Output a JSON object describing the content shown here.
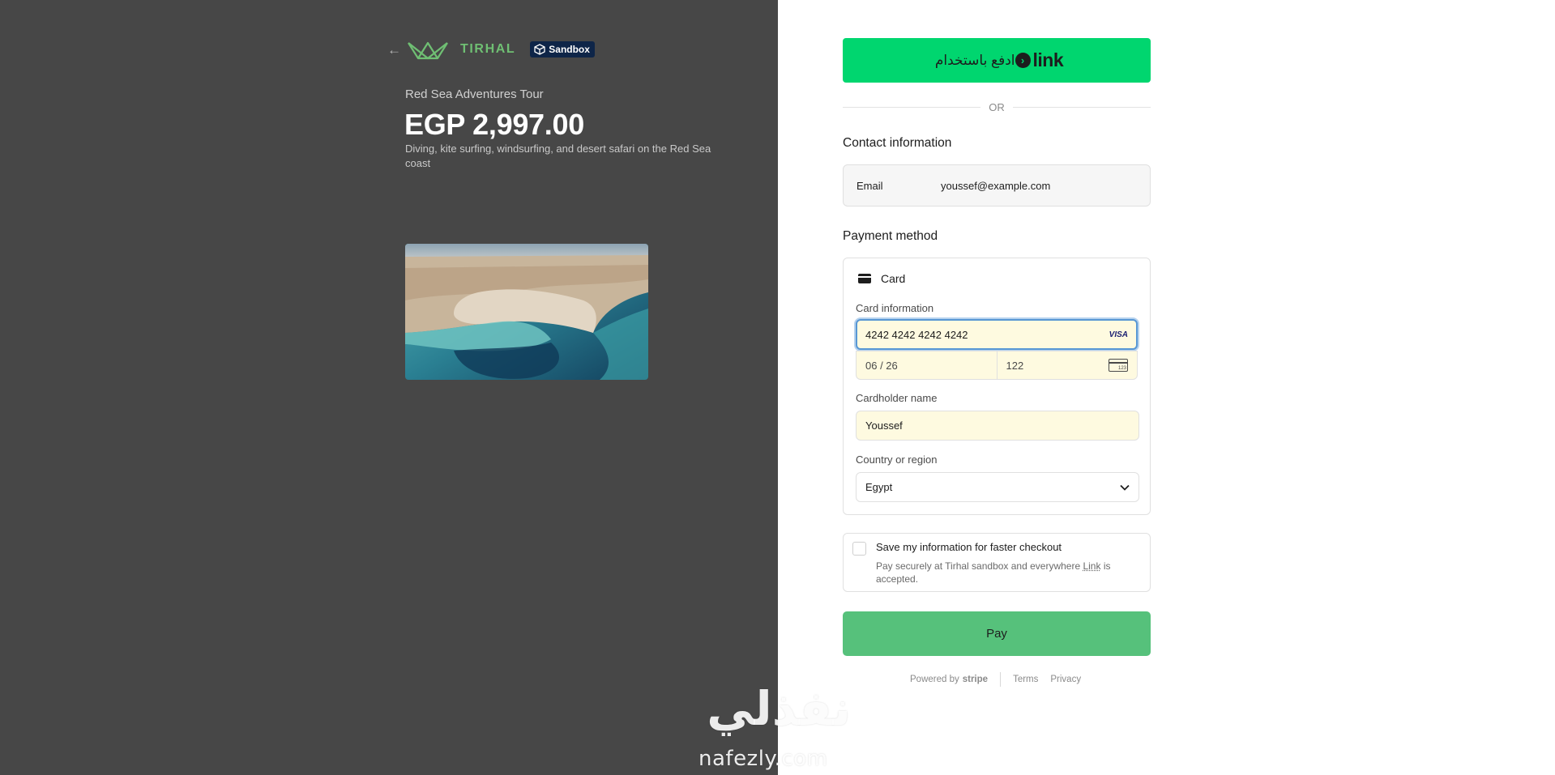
{
  "merchant": {
    "name": "TIRHAL",
    "sandbox_badge": "Sandbox",
    "back_icon": "arrow-left-icon",
    "logo_icon": "crown-logo-icon"
  },
  "product": {
    "name": "Red Sea Adventures Tour",
    "price": "EGP 2,997.00",
    "description": "Diving, kite surfing, windsurfing, and desert safari on the Red Sea coast"
  },
  "link_button": {
    "arabic_label": "ادفع باستخدام",
    "brand": "link"
  },
  "divider_label": "OR",
  "contact": {
    "title": "Contact information",
    "email_label": "Email",
    "email_value": "youssef@example.com"
  },
  "payment": {
    "title": "Payment method",
    "method_tab": "Card",
    "card_info_label": "Card information",
    "card_number": "4242 4242 4242 4242",
    "card_brand": "VISA",
    "expiry": "06 / 26",
    "cvc": "122",
    "cvc_icon_text": "123",
    "cardholder_label": "Cardholder name",
    "cardholder_value": "Youssef",
    "country_label": "Country or region",
    "country_value": "Egypt"
  },
  "save_info": {
    "title": "Save my information for faster checkout",
    "subtitle_prefix": "Pay securely at Tirhal sandbox and everywhere ",
    "subtitle_link": "Link",
    "subtitle_suffix": " is accepted."
  },
  "pay_button": "Pay",
  "footer": {
    "powered_by": "Powered by",
    "stripe": "stripe",
    "terms": "Terms",
    "privacy": "Privacy"
  },
  "watermark": {
    "arabic": "نفذلي",
    "latin": "nafezly.com"
  },
  "colors": {
    "left_panel": "#474747",
    "link_green": "#00d66f",
    "pay_green": "#56c17b",
    "autofill_yellow": "#fefae0",
    "focus_blue": "#5897d4",
    "brand_green": "#6fbf73",
    "sandbox_navy": "#0e2548"
  }
}
